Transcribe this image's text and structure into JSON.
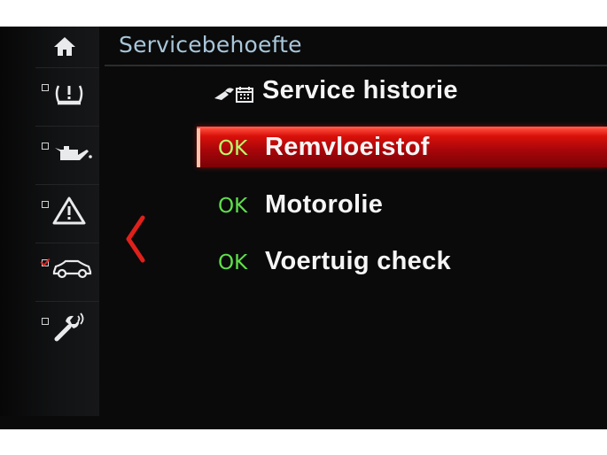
{
  "header": {
    "title": "Servicebehoefte"
  },
  "sidebar": {
    "home_icon": "home-icon",
    "items": [
      {
        "icon": "tire-pressure-icon",
        "checked": false
      },
      {
        "icon": "oil-can-icon",
        "checked": false
      },
      {
        "icon": "warning-triangle-icon",
        "checked": false
      },
      {
        "icon": "car-icon",
        "checked": true
      },
      {
        "icon": "wrench-icon",
        "checked": false
      }
    ]
  },
  "back": {
    "icon": "chevron-left-icon"
  },
  "menu": {
    "history": {
      "icon": "service-history-icon",
      "label": "Service historie"
    },
    "items": [
      {
        "status": "OK",
        "label": "Remvloeistof",
        "selected": true
      },
      {
        "status": "OK",
        "label": "Motorolie",
        "selected": false
      },
      {
        "status": "OK",
        "label": "Voertuig check",
        "selected": false
      }
    ]
  },
  "colors": {
    "header_text": "#a8c6d8",
    "status_ok": "#5fe04a",
    "selection_red": "#d8100a",
    "background": "#0a0a0b"
  }
}
